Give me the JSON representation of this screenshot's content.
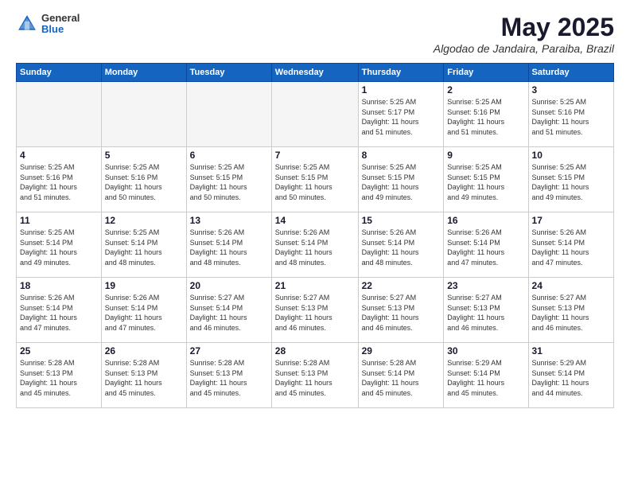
{
  "header": {
    "logo": {
      "general": "General",
      "blue": "Blue"
    },
    "title": "May 2025",
    "location": "Algodao de Jandaira, Paraiba, Brazil"
  },
  "calendar": {
    "weekdays": [
      "Sunday",
      "Monday",
      "Tuesday",
      "Wednesday",
      "Thursday",
      "Friday",
      "Saturday"
    ],
    "weeks": [
      [
        {
          "day": "",
          "info": "",
          "empty": true
        },
        {
          "day": "",
          "info": "",
          "empty": true
        },
        {
          "day": "",
          "info": "",
          "empty": true
        },
        {
          "day": "",
          "info": "",
          "empty": true
        },
        {
          "day": "1",
          "info": "Sunrise: 5:25 AM\nSunset: 5:17 PM\nDaylight: 11 hours\nand 51 minutes.",
          "empty": false
        },
        {
          "day": "2",
          "info": "Sunrise: 5:25 AM\nSunset: 5:16 PM\nDaylight: 11 hours\nand 51 minutes.",
          "empty": false
        },
        {
          "day": "3",
          "info": "Sunrise: 5:25 AM\nSunset: 5:16 PM\nDaylight: 11 hours\nand 51 minutes.",
          "empty": false
        }
      ],
      [
        {
          "day": "4",
          "info": "Sunrise: 5:25 AM\nSunset: 5:16 PM\nDaylight: 11 hours\nand 51 minutes.",
          "empty": false
        },
        {
          "day": "5",
          "info": "Sunrise: 5:25 AM\nSunset: 5:16 PM\nDaylight: 11 hours\nand 50 minutes.",
          "empty": false
        },
        {
          "day": "6",
          "info": "Sunrise: 5:25 AM\nSunset: 5:15 PM\nDaylight: 11 hours\nand 50 minutes.",
          "empty": false
        },
        {
          "day": "7",
          "info": "Sunrise: 5:25 AM\nSunset: 5:15 PM\nDaylight: 11 hours\nand 50 minutes.",
          "empty": false
        },
        {
          "day": "8",
          "info": "Sunrise: 5:25 AM\nSunset: 5:15 PM\nDaylight: 11 hours\nand 49 minutes.",
          "empty": false
        },
        {
          "day": "9",
          "info": "Sunrise: 5:25 AM\nSunset: 5:15 PM\nDaylight: 11 hours\nand 49 minutes.",
          "empty": false
        },
        {
          "day": "10",
          "info": "Sunrise: 5:25 AM\nSunset: 5:15 PM\nDaylight: 11 hours\nand 49 minutes.",
          "empty": false
        }
      ],
      [
        {
          "day": "11",
          "info": "Sunrise: 5:25 AM\nSunset: 5:14 PM\nDaylight: 11 hours\nand 49 minutes.",
          "empty": false
        },
        {
          "day": "12",
          "info": "Sunrise: 5:25 AM\nSunset: 5:14 PM\nDaylight: 11 hours\nand 48 minutes.",
          "empty": false
        },
        {
          "day": "13",
          "info": "Sunrise: 5:26 AM\nSunset: 5:14 PM\nDaylight: 11 hours\nand 48 minutes.",
          "empty": false
        },
        {
          "day": "14",
          "info": "Sunrise: 5:26 AM\nSunset: 5:14 PM\nDaylight: 11 hours\nand 48 minutes.",
          "empty": false
        },
        {
          "day": "15",
          "info": "Sunrise: 5:26 AM\nSunset: 5:14 PM\nDaylight: 11 hours\nand 48 minutes.",
          "empty": false
        },
        {
          "day": "16",
          "info": "Sunrise: 5:26 AM\nSunset: 5:14 PM\nDaylight: 11 hours\nand 47 minutes.",
          "empty": false
        },
        {
          "day": "17",
          "info": "Sunrise: 5:26 AM\nSunset: 5:14 PM\nDaylight: 11 hours\nand 47 minutes.",
          "empty": false
        }
      ],
      [
        {
          "day": "18",
          "info": "Sunrise: 5:26 AM\nSunset: 5:14 PM\nDaylight: 11 hours\nand 47 minutes.",
          "empty": false
        },
        {
          "day": "19",
          "info": "Sunrise: 5:26 AM\nSunset: 5:14 PM\nDaylight: 11 hours\nand 47 minutes.",
          "empty": false
        },
        {
          "day": "20",
          "info": "Sunrise: 5:27 AM\nSunset: 5:14 PM\nDaylight: 11 hours\nand 46 minutes.",
          "empty": false
        },
        {
          "day": "21",
          "info": "Sunrise: 5:27 AM\nSunset: 5:13 PM\nDaylight: 11 hours\nand 46 minutes.",
          "empty": false
        },
        {
          "day": "22",
          "info": "Sunrise: 5:27 AM\nSunset: 5:13 PM\nDaylight: 11 hours\nand 46 minutes.",
          "empty": false
        },
        {
          "day": "23",
          "info": "Sunrise: 5:27 AM\nSunset: 5:13 PM\nDaylight: 11 hours\nand 46 minutes.",
          "empty": false
        },
        {
          "day": "24",
          "info": "Sunrise: 5:27 AM\nSunset: 5:13 PM\nDaylight: 11 hours\nand 46 minutes.",
          "empty": false
        }
      ],
      [
        {
          "day": "25",
          "info": "Sunrise: 5:28 AM\nSunset: 5:13 PM\nDaylight: 11 hours\nand 45 minutes.",
          "empty": false
        },
        {
          "day": "26",
          "info": "Sunrise: 5:28 AM\nSunset: 5:13 PM\nDaylight: 11 hours\nand 45 minutes.",
          "empty": false
        },
        {
          "day": "27",
          "info": "Sunrise: 5:28 AM\nSunset: 5:13 PM\nDaylight: 11 hours\nand 45 minutes.",
          "empty": false
        },
        {
          "day": "28",
          "info": "Sunrise: 5:28 AM\nSunset: 5:13 PM\nDaylight: 11 hours\nand 45 minutes.",
          "empty": false
        },
        {
          "day": "29",
          "info": "Sunrise: 5:28 AM\nSunset: 5:14 PM\nDaylight: 11 hours\nand 45 minutes.",
          "empty": false
        },
        {
          "day": "30",
          "info": "Sunrise: 5:29 AM\nSunset: 5:14 PM\nDaylight: 11 hours\nand 45 minutes.",
          "empty": false
        },
        {
          "day": "31",
          "info": "Sunrise: 5:29 AM\nSunset: 5:14 PM\nDaylight: 11 hours\nand 44 minutes.",
          "empty": false
        }
      ]
    ]
  }
}
